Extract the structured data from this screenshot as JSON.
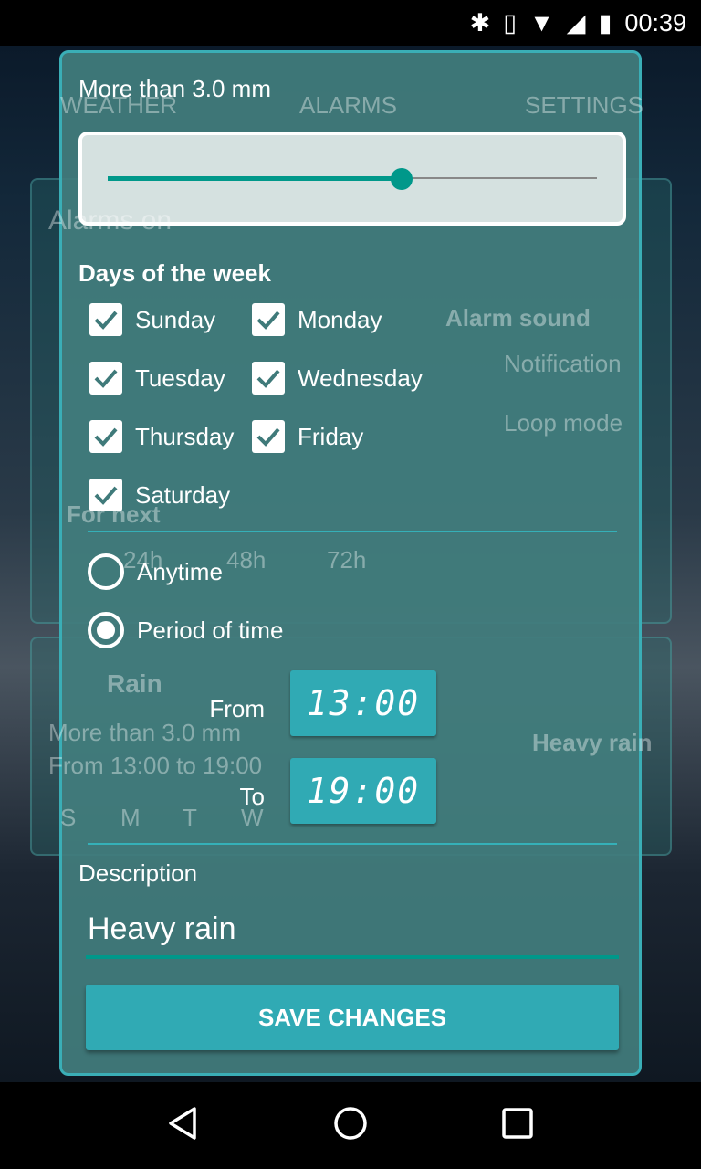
{
  "status_bar": {
    "time": "00:39",
    "icons": [
      "bluetooth-icon",
      "vibrate-icon",
      "wifi-icon",
      "signal-icon",
      "battery-icon"
    ]
  },
  "background": {
    "tabs": [
      "WEATHER",
      "ALARMS",
      "SETTINGS"
    ],
    "alarms_on": "Alarms on",
    "alarm_sound": "Alarm sound",
    "sound_options": [
      "Notification",
      "Loop mode"
    ],
    "for_next": "For next",
    "for_next_options": [
      "24h",
      "48h",
      "72h"
    ],
    "alarm_card": {
      "title": "Rain",
      "line1": "More than 3.0 mm",
      "line2": "From 13:00 to 19:00",
      "description": "Heavy rain",
      "days": [
        "S",
        "M",
        "T",
        "W"
      ]
    }
  },
  "dialog": {
    "threshold_label": "More than 3.0 mm",
    "slider_fraction": 0.6,
    "days_title": "Days of the week",
    "days": [
      {
        "label": "Sunday",
        "checked": true
      },
      {
        "label": "Monday",
        "checked": true
      },
      {
        "label": "Tuesday",
        "checked": true
      },
      {
        "label": "Wednesday",
        "checked": true
      },
      {
        "label": "Thursday",
        "checked": true
      },
      {
        "label": "Friday",
        "checked": true
      },
      {
        "label": "Saturday",
        "checked": true
      }
    ],
    "time_options": [
      {
        "label": "Anytime",
        "selected": false
      },
      {
        "label": "Period of time",
        "selected": true
      }
    ],
    "from_label": "From",
    "from_time": "13:00",
    "to_label": "To",
    "to_time": "19:00",
    "description_label": "Description",
    "description_value": "Heavy rain",
    "save_label": "SAVE CHANGES"
  },
  "colors": {
    "accent": "#00988a",
    "button": "#30aab4",
    "dialog_border": "#3aaeb6"
  }
}
